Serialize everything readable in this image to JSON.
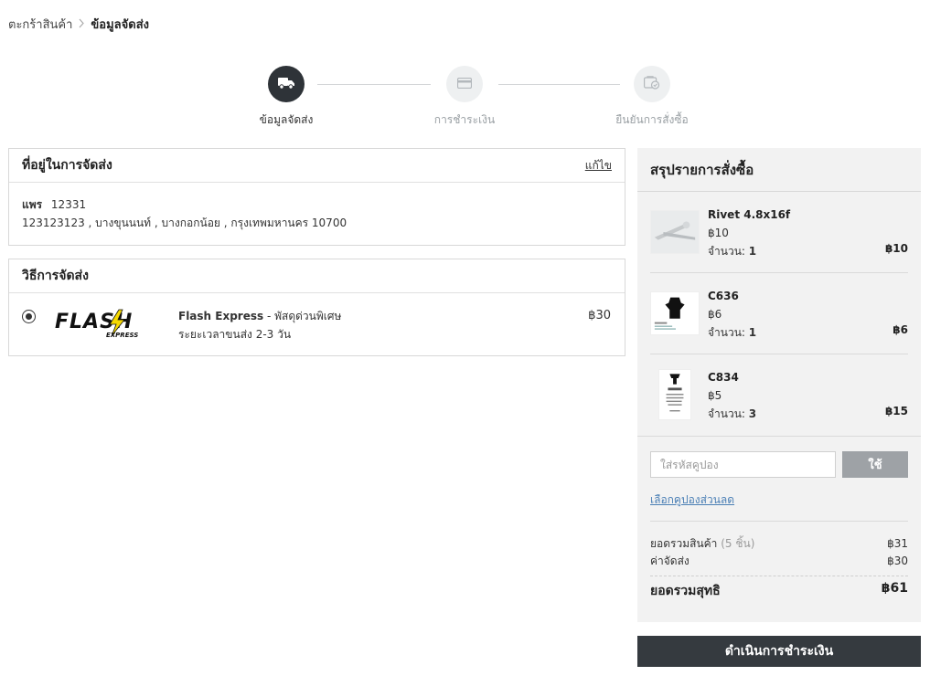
{
  "breadcrumb": {
    "cart": "ตะกร้าสินค้า",
    "separator": ">",
    "current": "ข้อมูลจัดส่ง"
  },
  "steps": [
    {
      "label": "ข้อมูลจัดส่ง",
      "icon": "truck-icon",
      "state": "active"
    },
    {
      "label": "การชำระเงิน",
      "icon": "credit-card-icon",
      "state": "inactive"
    },
    {
      "label": "ยืนยันการสั่งซื้อ",
      "icon": "wallet-check-icon",
      "state": "inactive"
    }
  ],
  "address": {
    "title": "ที่อยู่ในการจัดส่ง",
    "edit_label": "แก้ไข",
    "name": "แพร",
    "phone": "12331",
    "line": "123123123 , บางขุนนนท์ , บางกอกน้อย , กรุงเทพมหานคร 10700"
  },
  "shipping": {
    "title": "วิธีการจัดส่ง",
    "logo_text": "FLASH",
    "logo_subtext": "EXPRESS",
    "option_name": "Flash Express",
    "option_suffix": " - พัสดุด่วนพิเศษ",
    "duration": "ระยะเวลาขนส่ง 2-3 วัน",
    "price": "฿30",
    "selected": true
  },
  "summary": {
    "title": "สรุปรายการสั่งซื้อ",
    "qty_label": "จำนวน: ",
    "items": [
      {
        "name": "Rivet 4.8x16f",
        "price": "฿10",
        "qty": "1",
        "total": "฿10"
      },
      {
        "name": "C636",
        "price": "฿6",
        "qty": "1",
        "total": "฿6"
      },
      {
        "name": "C834",
        "price": "฿5",
        "qty": "3",
        "total": "฿15"
      }
    ],
    "coupon_placeholder": "ใส่รหัสคูปอง",
    "apply_label": "ใช้",
    "coupon_link": "เลือกคูปองส่วนลด",
    "subtotal_label": "ยอดรวมสินค้า",
    "subtotal_count": " (5 ชิ้น)",
    "subtotal_value": "฿31",
    "shipping_label": "ค่าจัดส่ง",
    "shipping_value": "฿30",
    "grand_label": "ยอดรวมสุทธิ",
    "grand_value": "฿61"
  },
  "checkout_label": "ดำเนินการชำระเงิน",
  "colors": {
    "active_step": "#2e3338",
    "inactive_step": "#eef0f1",
    "checkout_button": "#353a3f",
    "link": "#4a7fb5",
    "flash_bolt": "#f5d800"
  }
}
